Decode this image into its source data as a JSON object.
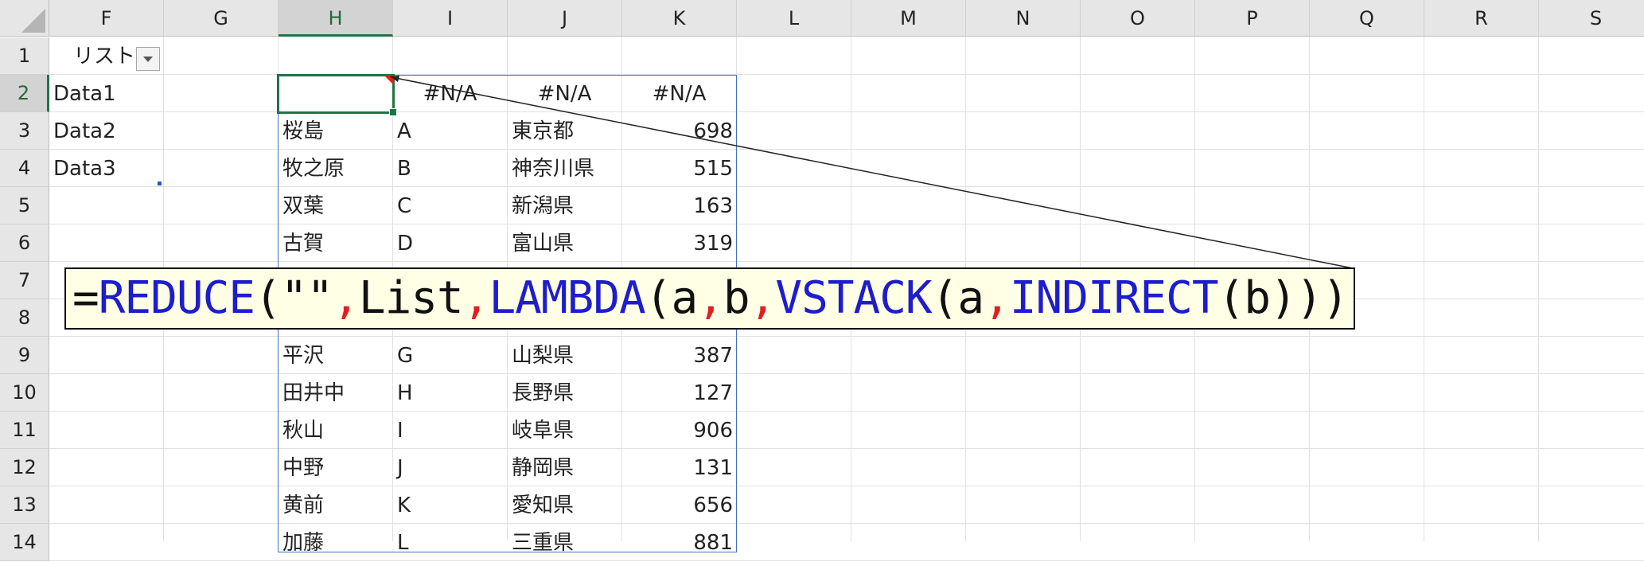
{
  "columns": [
    "F",
    "G",
    "H",
    "I",
    "J",
    "K",
    "L",
    "M",
    "N",
    "O",
    "P",
    "Q",
    "R",
    "S"
  ],
  "rows": [
    "1",
    "2",
    "3",
    "4",
    "5",
    "6",
    "7",
    "8",
    "9",
    "10",
    "11",
    "12",
    "13",
    "14"
  ],
  "f_column": {
    "header_cell": "リスト",
    "values": [
      "Data1",
      "Data2",
      "Data3"
    ]
  },
  "header_row": [
    "",
    "#N/A",
    "#N/A",
    "#N/A"
  ],
  "table_rows": [
    {
      "name": "桜島",
      "code": "A",
      "pref": "東京都",
      "value": "698"
    },
    {
      "name": "牧之原",
      "code": "B",
      "pref": "神奈川県",
      "value": "515"
    },
    {
      "name": "双葉",
      "code": "C",
      "pref": "新潟県",
      "value": "163"
    },
    {
      "name": "古賀",
      "code": "D",
      "pref": "富山県",
      "value": "319"
    },
    {
      "name": "平沢",
      "code": "G",
      "pref": "山梨県",
      "value": "387"
    },
    {
      "name": "田井中",
      "code": "H",
      "pref": "長野県",
      "value": "127"
    },
    {
      "name": "秋山",
      "code": "I",
      "pref": "岐阜県",
      "value": "906"
    },
    {
      "name": "中野",
      "code": "J",
      "pref": "静岡県",
      "value": "131"
    },
    {
      "name": "黄前",
      "code": "K",
      "pref": "愛知県",
      "value": "656"
    },
    {
      "name": "加藤",
      "code": "L",
      "pref": "三重県",
      "value": "881"
    }
  ],
  "formula": {
    "p1": "=",
    "p2": "REDUCE",
    "p3": "(\"\"",
    "p4": ",",
    "p5": "List",
    "p6": ",",
    "p7": "LAMBDA",
    "p8": "(a",
    "p9": ",",
    "p10": "b",
    "p11": ",",
    "p12": "VSTACK",
    "p13": "(a",
    "p14": ",",
    "p15": "INDIRECT",
    "p16": "(b))))"
  },
  "colors": {
    "accent": "#217346",
    "spill_border": "#4472c4",
    "function": "#1d1dcf",
    "separator": "#e02020",
    "note_bg": "#ffffe6"
  }
}
